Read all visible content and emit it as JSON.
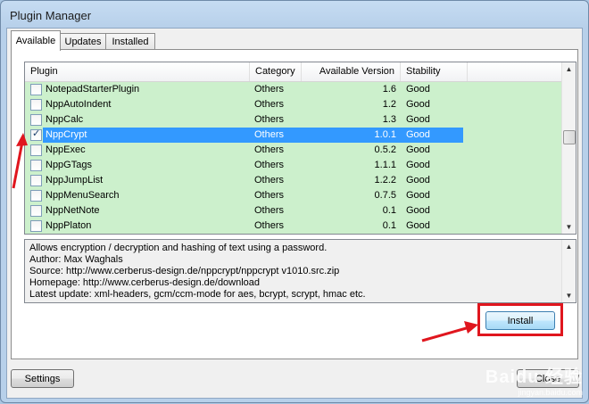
{
  "window": {
    "title": "Plugin Manager"
  },
  "tabs": [
    {
      "label": "Available",
      "active": true
    },
    {
      "label": "Updates",
      "active": false
    },
    {
      "label": "Installed",
      "active": false
    }
  ],
  "table": {
    "columns": [
      "Plugin",
      "Category",
      "Available Version",
      "Stability"
    ],
    "rows": [
      {
        "checked": false,
        "name": "NotepadStarterPlugin",
        "category": "Others",
        "version": "1.6",
        "stability": "Good"
      },
      {
        "checked": false,
        "name": "NppAutoIndent",
        "category": "Others",
        "version": "1.2",
        "stability": "Good"
      },
      {
        "checked": false,
        "name": "NppCalc",
        "category": "Others",
        "version": "1.3",
        "stability": "Good"
      },
      {
        "checked": true,
        "name": "NppCrypt",
        "category": "Others",
        "version": "1.0.1",
        "stability": "Good",
        "selected": true
      },
      {
        "checked": false,
        "name": "NppExec",
        "category": "Others",
        "version": "0.5.2",
        "stability": "Good"
      },
      {
        "checked": false,
        "name": "NppGTags",
        "category": "Others",
        "version": "1.1.1",
        "stability": "Good"
      },
      {
        "checked": false,
        "name": "NppJumpList",
        "category": "Others",
        "version": "1.2.2",
        "stability": "Good"
      },
      {
        "checked": false,
        "name": "NppMenuSearch",
        "category": "Others",
        "version": "0.7.5",
        "stability": "Good"
      },
      {
        "checked": false,
        "name": "NppNetNote",
        "category": "Others",
        "version": "0.1",
        "stability": "Good"
      },
      {
        "checked": false,
        "name": "NppPlaton",
        "category": "Others",
        "version": "0.1",
        "stability": "Good"
      }
    ],
    "row_color": "#ccf0cc",
    "selection_color": "#3399ff"
  },
  "description": {
    "lines": [
      "Allows encryption / decryption and hashing of text using a password.",
      "Author: Max Waghals",
      "Source: http://www.cerberus-design.de/nppcrypt/nppcrypt v1010.src.zip",
      "Homepage: http://www.cerberus-design.de/download",
      "Latest update: xml-headers, gcm/ccm-mode for aes, bcrypt, scrypt, hmac etc."
    ]
  },
  "buttons": {
    "install": "Install",
    "settings": "Settings",
    "close": "Close"
  },
  "icons": {
    "scroll_up": "▲",
    "scroll_down": "▼",
    "check": "✓"
  },
  "annotation": {
    "color": "#e0161e"
  },
  "watermark": {
    "brand": "Baidu 经验",
    "url": "jingyan.baidu.com"
  }
}
